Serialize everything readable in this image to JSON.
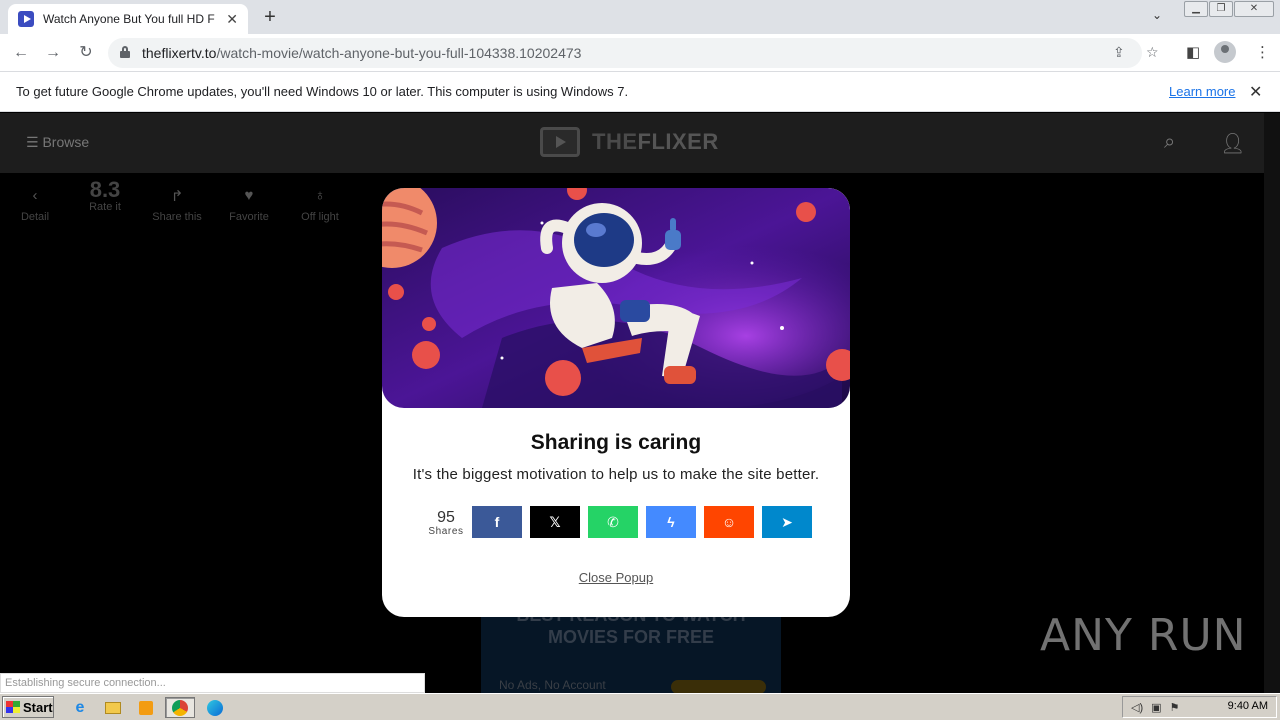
{
  "browser": {
    "tab_title": "Watch Anyone But You full HD Free",
    "new_tab_symbol": "+",
    "url_host": "theflixertv.to",
    "url_path": "/watch-movie/watch-anyone-but-you-full-104338.10202473"
  },
  "infobar": {
    "message": "To get future Google Chrome updates, you'll need Windows 10 or later. This computer is using Windows 7.",
    "link": "Learn more"
  },
  "site": {
    "browse_label": "Browse",
    "brand_light": "THE",
    "brand_bold": "FLIXER",
    "actions": [
      {
        "label": "Detail",
        "icon": "chevron-left-icon"
      },
      {
        "label": "Rate it",
        "value": "8.3"
      },
      {
        "label": "Share this",
        "icon": "share-icon"
      },
      {
        "label": "Favorite",
        "icon": "heart-icon"
      },
      {
        "label": "Off light",
        "icon": "bulb-icon"
      }
    ],
    "promo_line1": "BEST REASON TO WATCH",
    "promo_line2": "MOVIES FOR FREE",
    "promo_sub": "No Ads, No Account"
  },
  "popup": {
    "title": "Sharing is caring",
    "subtitle": "It's the biggest motivation to help us to make the site better.",
    "share_count": "95",
    "share_caption": "Shares",
    "close_label": "Close Popup",
    "networks": [
      {
        "name": "facebook",
        "glyph": "f",
        "color": "#3b5998"
      },
      {
        "name": "x",
        "glyph": "𝕏",
        "color": "#000000"
      },
      {
        "name": "whatsapp",
        "glyph": "✆",
        "color": "#25d366"
      },
      {
        "name": "messenger",
        "glyph": "ϟ",
        "color": "#448aff"
      },
      {
        "name": "reddit",
        "glyph": "☺",
        "color": "#ff4500"
      },
      {
        "name": "telegram",
        "glyph": "➤",
        "color": "#0088cc"
      }
    ]
  },
  "status_text": "Establishing secure connection...",
  "watermark": "ANY RUN",
  "taskbar": {
    "start_label": "Start",
    "clock": "9:40 AM"
  }
}
